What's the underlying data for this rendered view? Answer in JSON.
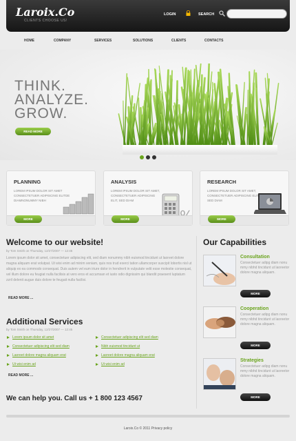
{
  "header": {
    "logo": "Laroix.Co",
    "tagline": "CLIENTS CHOOSE US!",
    "login": "LOGIN",
    "search_label": "SEARCH",
    "search_value": ""
  },
  "nav": [
    "HOME",
    "COMPANY",
    "SERVICES",
    "SOLUTIONS",
    "CLIENTS",
    "CONTACTS"
  ],
  "hero": {
    "lines": [
      "THINK.",
      "ANALYZE.",
      "GROW."
    ],
    "button": "READ MORE"
  },
  "boxes": [
    {
      "title": "PLANNING",
      "text": "LOREM IPSUM DOLOR SIT AMET CONSECTETUER ADIPISCING ELITDE DIAMNONUMMY NIBH",
      "button": "MORE"
    },
    {
      "title": "ANALYSIS",
      "text": "LOREM IPSUM DOLOR SIT AMET, CONSECTETUER ADIPISCING ELIT, SED DIAM",
      "button": "MORE"
    },
    {
      "title": "RESEARCH",
      "text": "LOREM IPSUM DOLOR SIT AMET, CONSECTETUER ADIPISCING ELIT, SED DIAM",
      "button": "MORE"
    }
  ],
  "welcome": {
    "title": "Welcome to our website!",
    "meta": "by Tom Smith on Thursday, 12/27/2007 — 12:45",
    "text": "Lorem ipsum dolor sit amet, consectetuer adipiscing elit, sed diam nonummy nibh euismod tincidunt ut laoreet dolore magna aliquam erat volutpat. Ut wisi enim ad minim veniam, quis nos trud exerci tation ullamcorper suscipit lobortis nisl ut aliquip ex ea commodo consequat. Duis autem vel eum iriure dolor in hendrerit in vulputate velit esse molestie consequat, vel illum dolore eu feugiat nulla facilisis at vero eros et accumsan et iusto odio dignissim qui blandit praesent luptatum zzril delenit augue duis dolore te feugait nulla facilisi.",
    "read_more": "READ MORE ..."
  },
  "services": {
    "title": "Additional Services",
    "meta": "by Tom Smith on Thursday, 12/27/2007 — 12:45",
    "left": [
      "Lorem ipsum dolor sit amet",
      "Consectetuer adipiscing elit sed diam",
      "Laoreet dolore magna aliquam erat",
      "Ut wisi enim ad"
    ],
    "right": [
      "Consectetuer adipiscing elit sed diam",
      "Nibh euismod tincidunt ut",
      "Laoreet dolore magna aliquam erat",
      "Ut wisi enim ad"
    ],
    "read_more": "READ MORE ..."
  },
  "cta": "We can help you. Call us + 1 800 123 4567",
  "capabilities": {
    "title": "Our Capabilities",
    "items": [
      {
        "title": "Consultation",
        "text": "Consectetuer adipg diam nonu mmy nibhd tincidunt ut laoreetor dolore magna aliquam.",
        "button": "MORE"
      },
      {
        "title": "Cooperation",
        "text": "Consectetuer adipg diam nonu mmy nibhd tincidunt ut laoreetor dolore magna aliquam.",
        "button": "MORE"
      },
      {
        "title": "Strategies",
        "text": "Consectetuer adipg diam nonu mmy nibhd tincidunt ut laoreetor dolore magna aliquam.",
        "button": "MORE"
      }
    ]
  },
  "footer": "Laroix.Co © 2011 Privacy policy",
  "colors": {
    "accent": "#6aa41d",
    "header": "#1e1e1e",
    "background": "#ececec"
  }
}
